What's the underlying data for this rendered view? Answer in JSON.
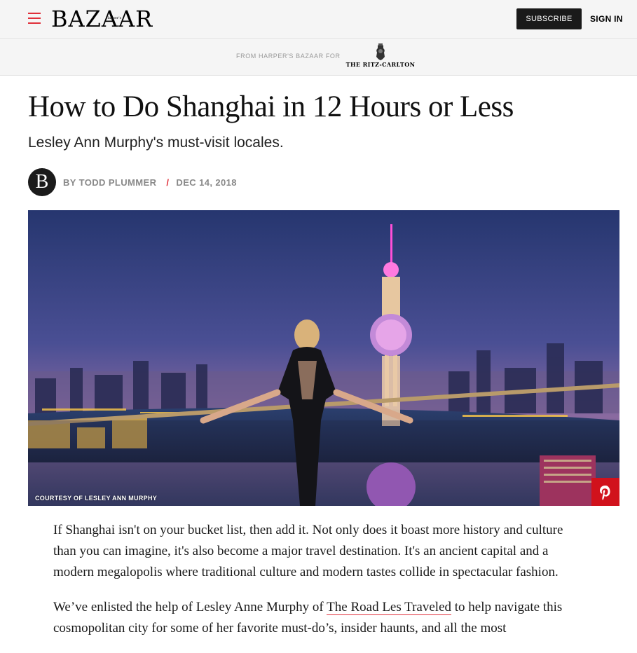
{
  "header": {
    "brand_small": "Harper's",
    "brand": "BAZAAR",
    "subscribe_label": "SUBSCRIBE",
    "signin_label": "SIGN IN"
  },
  "sponsor": {
    "text": "FROM HARPER'S BAZAAR FOR",
    "partner": "THE RITZ-CARLTON"
  },
  "article": {
    "title": "How to Do Shanghai in 12 Hours or Less",
    "dek": "Lesley Ann Murphy's must-visit locales.",
    "avatar_letter": "B",
    "byline_prefix": "BY",
    "author": "TODD PLUMMER",
    "separator": "/",
    "date": "DEC 14, 2018",
    "image_credit": "COURTESY OF LESLEY ANN MURPHY",
    "paragraph_1": "If Shanghai isn't on your bucket list, then add it. Not only does it boast more history and culture than you can imagine, it's also become a major travel destination. It's an ancient capital and a modern megalopolis where traditional culture and modern tastes collide in spectacular fashion.",
    "paragraph_2_before": "We’ve enlisted the help of Lesley Anne Murphy of ",
    "paragraph_2_link": "The Road Les Traveled",
    "paragraph_2_after": " to help navigate this cosmopolitan city for some of her favorite must-do’s, insider haunts, and all the most"
  },
  "icons": {
    "menu": "hamburger-menu-icon",
    "pinterest": "pinterest-icon",
    "ritz_crest": "ritz-carlton-lion-crest-icon"
  },
  "colors": {
    "accent_red": "#e0303a",
    "pinterest_red": "#d1121c",
    "subscribe_bg": "#1a1a1a"
  }
}
